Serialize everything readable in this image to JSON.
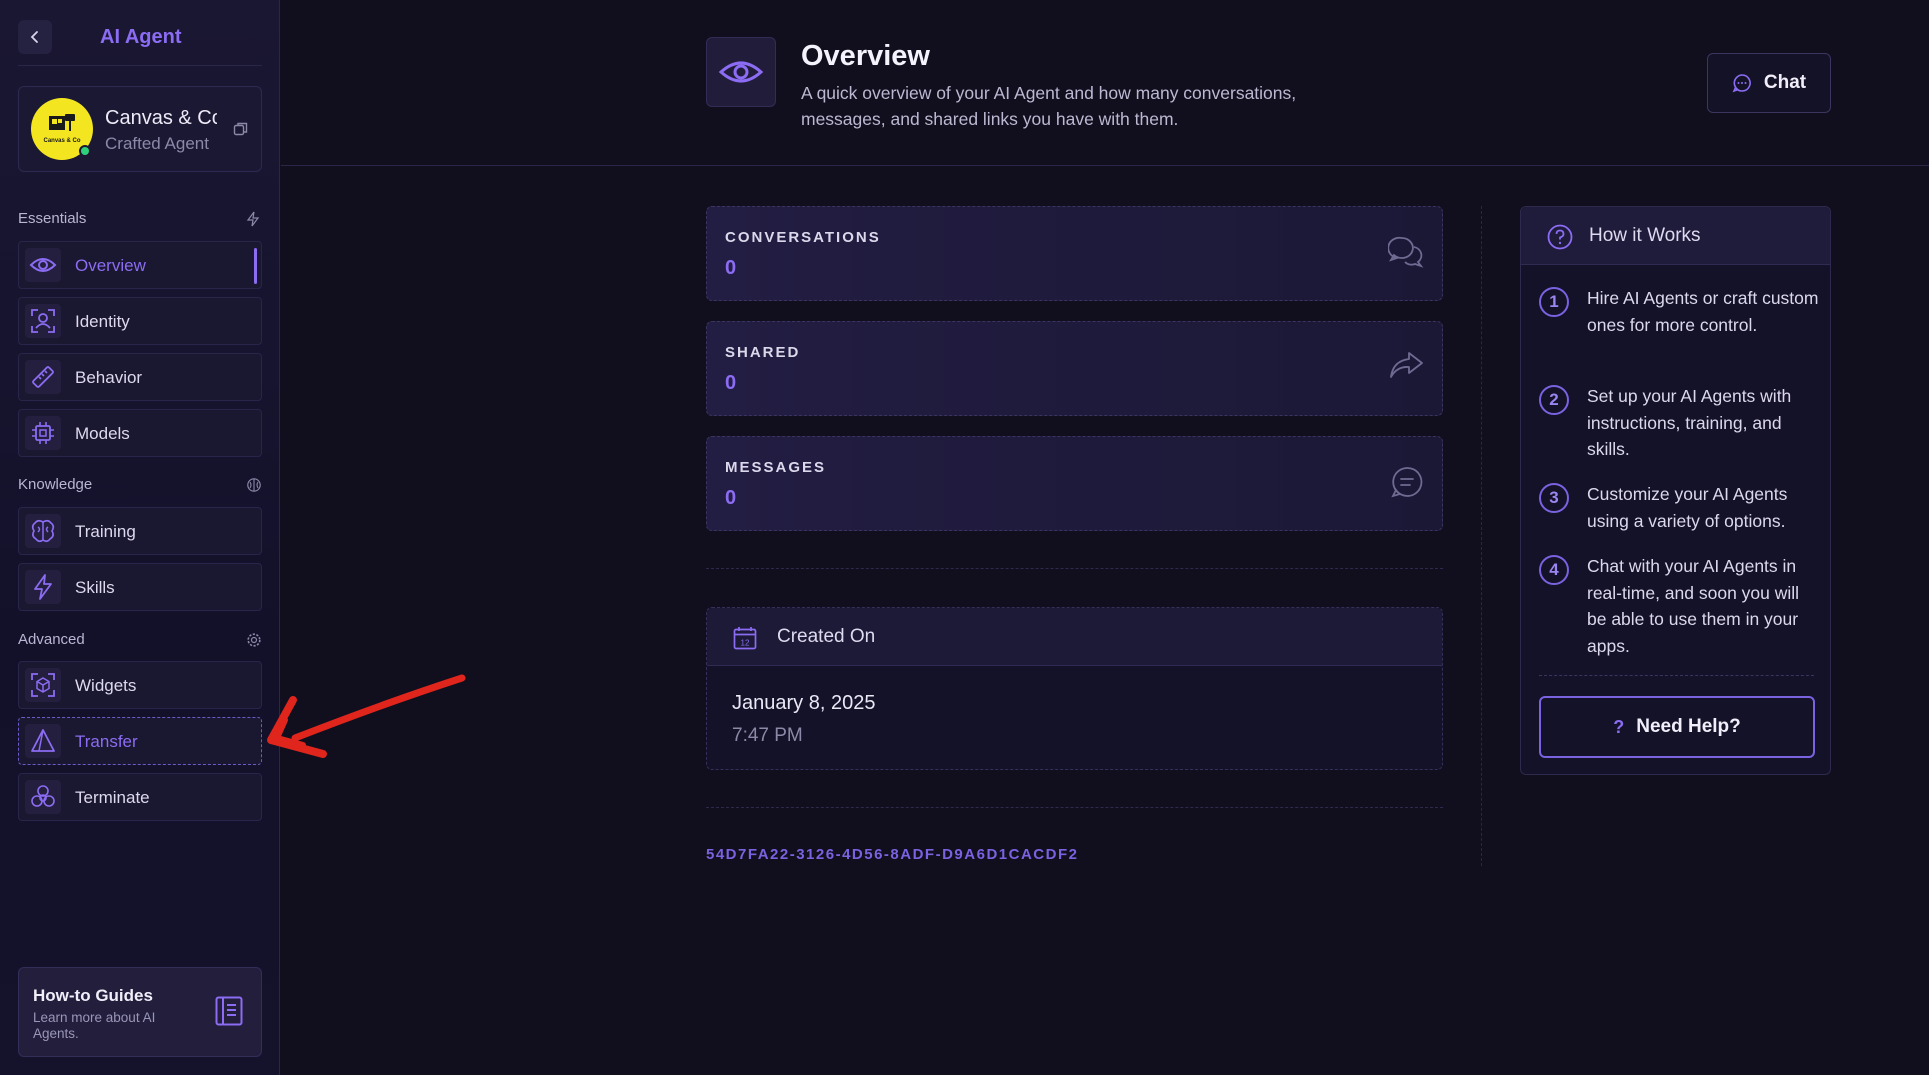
{
  "sidebar": {
    "title": "AI Agent",
    "agent": {
      "name": "Canvas & Co",
      "subtitle": "Crafted Agent",
      "logo_text": "Canvas & Co"
    },
    "sections": {
      "essentials": "Essentials",
      "knowledge": "Knowledge",
      "advanced": "Advanced"
    },
    "items": [
      {
        "label": "Overview",
        "icon": "eye-icon"
      },
      {
        "label": "Identity",
        "icon": "identity-icon"
      },
      {
        "label": "Behavior",
        "icon": "ruler-icon"
      },
      {
        "label": "Models",
        "icon": "chip-icon"
      },
      {
        "label": "Training",
        "icon": "brain-icon"
      },
      {
        "label": "Skills",
        "icon": "bolt-icon"
      },
      {
        "label": "Widgets",
        "icon": "cube-icon"
      },
      {
        "label": "Transfer",
        "icon": "triangle-icon"
      },
      {
        "label": "Terminate",
        "icon": "biohazard-icon"
      }
    ],
    "guide": {
      "title": "How-to Guides",
      "subtitle": "Learn more about AI Agents."
    }
  },
  "header": {
    "title": "Overview",
    "description": "A quick overview of your AI Agent and how many conversations, messages, and shared links you have with them.",
    "chat_label": "Chat"
  },
  "stats": [
    {
      "label": "CONVERSATIONS",
      "value": "0",
      "icon": "chat-bubbles-icon"
    },
    {
      "label": "SHARED",
      "value": "0",
      "icon": "share-arrow-icon"
    },
    {
      "label": "MESSAGES",
      "value": "0",
      "icon": "message-icon"
    }
  ],
  "created": {
    "title": "Created On",
    "calendar_day": "12",
    "date": "January 8, 2025",
    "time": "7:47 PM"
  },
  "uuid": "54D7FA22-3126-4D56-8ADF-D9A6D1CACDF2",
  "how_it_works": {
    "title": "How it Works",
    "steps": [
      {
        "num": "1",
        "text": "Hire AI Agents or craft custom ones for more control."
      },
      {
        "num": "2",
        "text": "Set up your AI Agents with instructions, training, and skills."
      },
      {
        "num": "3",
        "text": "Customize your AI Agents using a variety of options."
      },
      {
        "num": "4",
        "text": "Chat with your AI Agents in real-time, and soon you will be able to use them in your apps."
      }
    ],
    "help_label": "Need Help?"
  },
  "colors": {
    "accent": "#8b6cf2",
    "background": "#110f1e",
    "annotation": "#e0261c"
  }
}
